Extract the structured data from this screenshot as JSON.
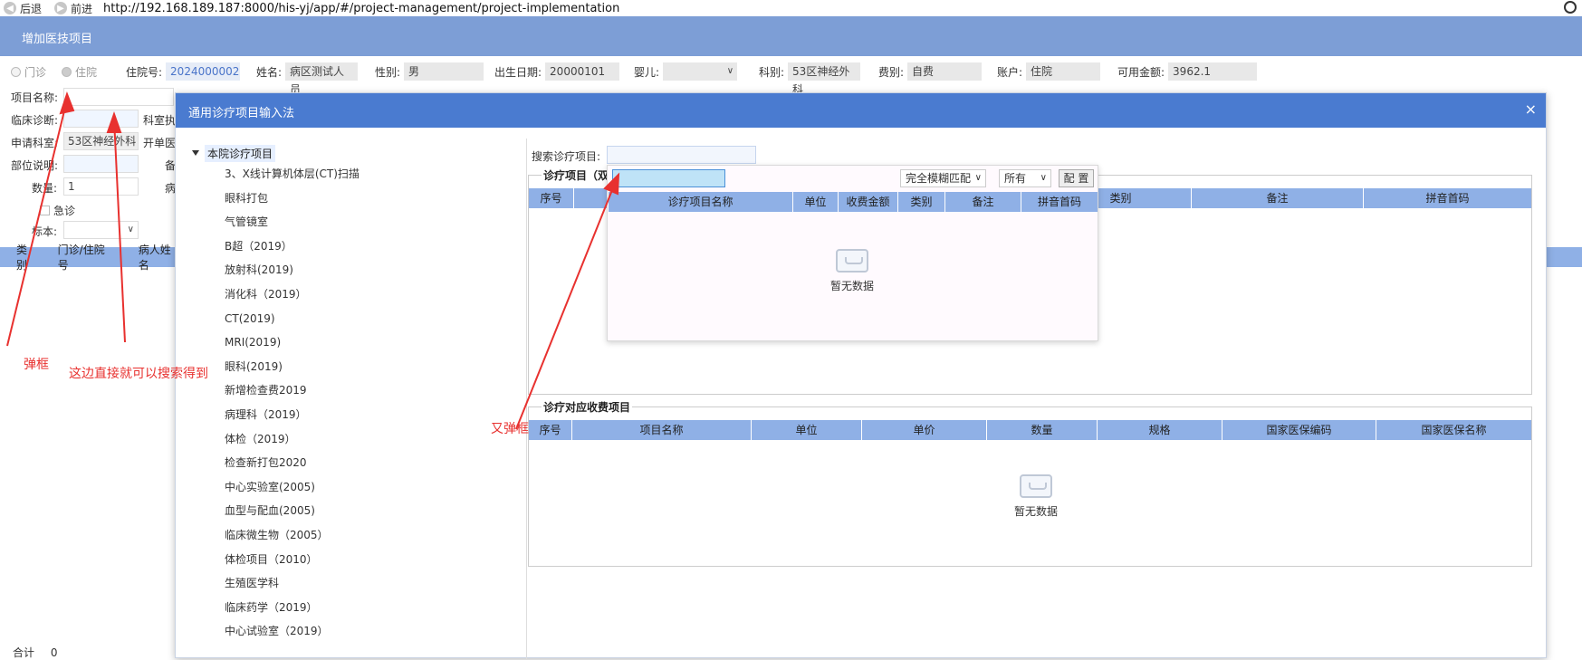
{
  "browser": {
    "back_label": "后退",
    "forward_label": "前进",
    "url": "http://192.168.189.187:8000/his-yj/app/#/project-management/project-implementation"
  },
  "header": {
    "title": "增加医技项目"
  },
  "patient": {
    "outpatient_label": "门诊",
    "inpatient_label": "住院",
    "admission_no_label": "住院号:",
    "admission_no": "2024000002",
    "name_label": "姓名:",
    "name": "病区测试人员",
    "gender_label": "性别:",
    "gender": "男",
    "birthdate_label": "出生日期:",
    "birthdate": "20000101",
    "infant_label": "婴儿:",
    "department_label": "科别:",
    "department": "53区神经外科",
    "fee_type_label": "费别:",
    "fee_type": "自费",
    "account_label": "账户:",
    "account": "住院",
    "balance_label": "可用金额:",
    "balance": "3962.1"
  },
  "left_form": {
    "item_name_label": "项目名称:",
    "clinical_diagnosis_label": "临床诊断:",
    "dept_exec_label": "科室执",
    "apply_dept_label": "申请科室:",
    "apply_dept_value": "53区神经外科",
    "order_label": "开单医",
    "site_label": "部位说明:",
    "remark_label": "备",
    "quantity_label": "数量:",
    "quantity_value": "1",
    "disease_label": "病",
    "urgent_label": "急诊",
    "specimen_label": "标本:"
  },
  "left_list": {
    "headers": [
      "类别",
      "门诊/住院号",
      "病人姓名"
    ],
    "total_label": "合计",
    "total_value": "0"
  },
  "modal": {
    "title": "通用诊疗项目输入法",
    "close": "×",
    "tree_root": "本院诊疗项目",
    "tree_items": [
      "3、X线计算机体层(CT)扫描",
      "眼科打包",
      "气管镜室",
      "B超（2019）",
      "放射科(2019)",
      "消化科（2019）",
      "CT(2019)",
      "MRI(2019)",
      "眼科(2019)",
      "新增检查费2019",
      "病理科（2019）",
      "体检（2019）",
      "检查新打包2020",
      "中心实验室(2005)",
      "血型与配血(2005)",
      "临床微生物（2005）",
      "体检项目（2010）",
      "生殖医学科",
      "临床药学（2019）",
      "中心试验室（2019）"
    ],
    "search_label": "搜索诊疗项目:",
    "items_legend": "诊疗项目（双",
    "items_headers": [
      "序号",
      "类别",
      "备注",
      "拼音首码"
    ],
    "fees_legend": "诊疗对应收费项目",
    "fees_headers": [
      "序号",
      "项目名称",
      "单位",
      "单价",
      "数量",
      "规格",
      "国家医保编码",
      "国家医保名称"
    ],
    "fees_empty": "暂无数据"
  },
  "popup": {
    "match_mode": "完全模糊匹配",
    "scope": "所有",
    "config_label": "配 置",
    "headers": [
      "诊疗项目名称",
      "单位",
      "收费金额",
      "类别",
      "备注",
      "拼音首码"
    ],
    "empty": "暂无数据"
  },
  "annotations": {
    "popup_note_1": "弹框",
    "search_note": "这边直接就可以搜索得到",
    "popup_note_2": "又弹框"
  },
  "colors": {
    "header": "#7d9ed6",
    "modal_header": "#4a7bd0",
    "table_header": "#8fb0e6",
    "annotation": "#e8312f"
  }
}
